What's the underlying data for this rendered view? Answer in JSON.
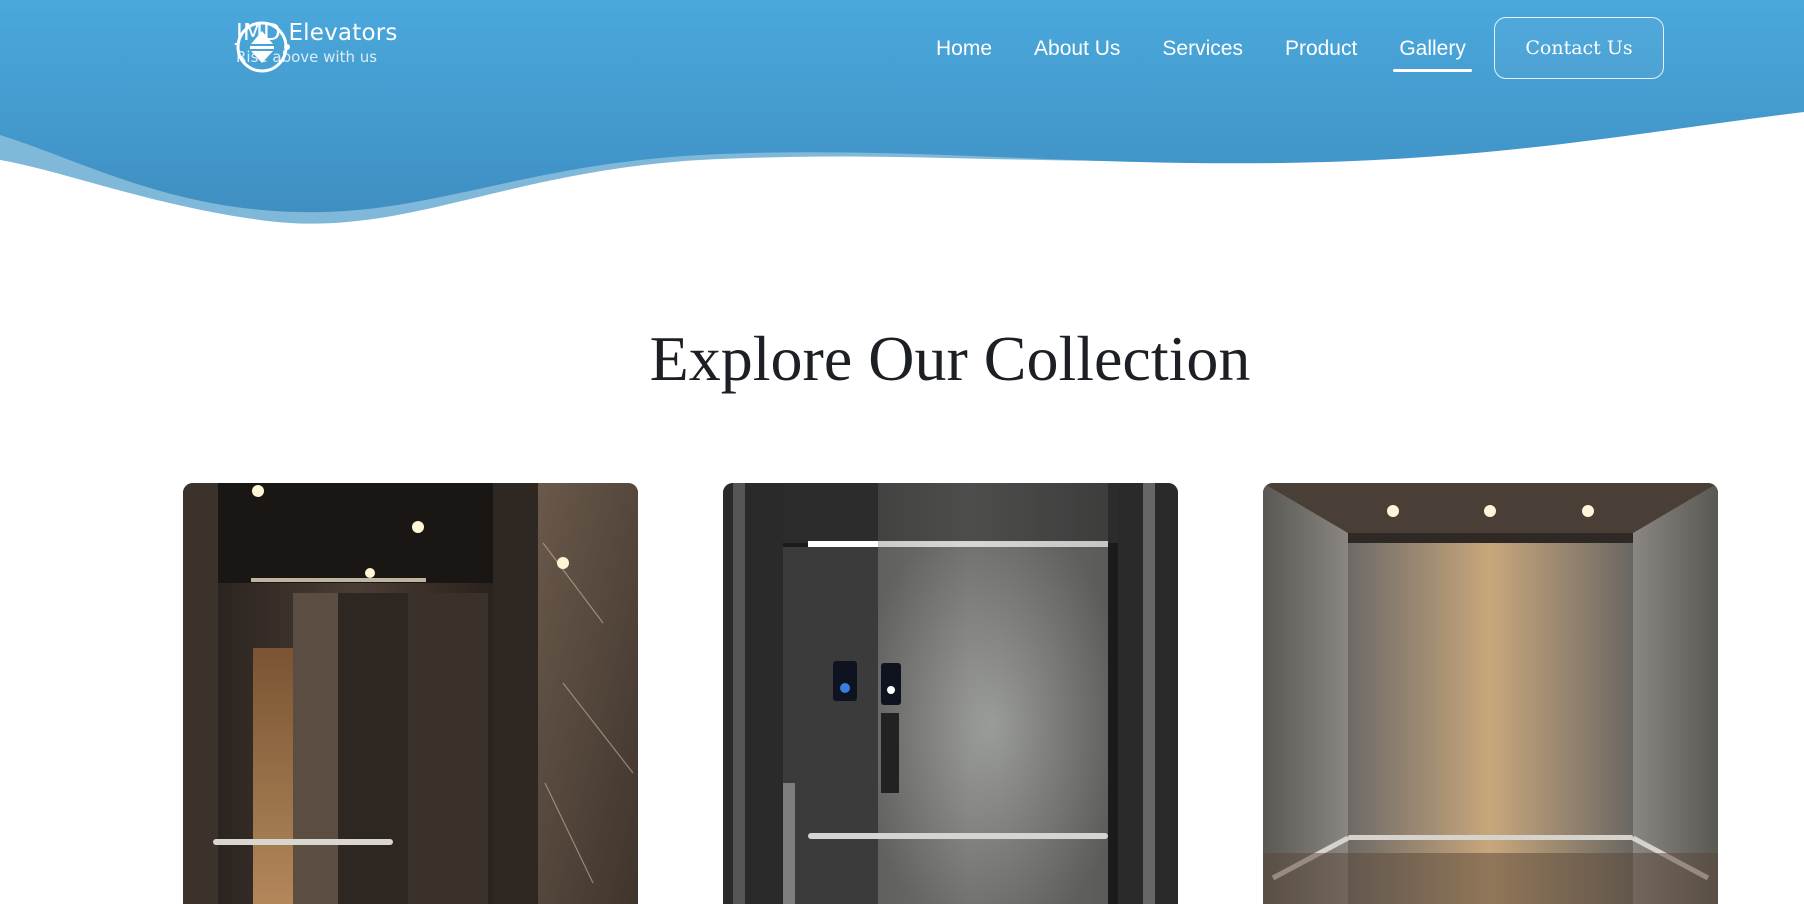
{
  "brand": {
    "name": "JMD Elevators",
    "tagline": "Rise above with us",
    "logo_icon": "elevator-up-down-icon"
  },
  "nav": {
    "items": [
      {
        "label": "Home",
        "active": false
      },
      {
        "label": "About Us",
        "active": false
      },
      {
        "label": "Services",
        "active": false
      },
      {
        "label": "Product",
        "active": false
      },
      {
        "label": "Gallery",
        "active": true
      }
    ],
    "contact_label": "Contact Us"
  },
  "colors": {
    "hero_top": "#4aa8dc",
    "hero_bottom": "#3f8fc2",
    "wave_light": "#7fb8d8",
    "title": "#1c1f24"
  },
  "main": {
    "title": "Explore Our Collection",
    "gallery": [
      {
        "name": "dark-bronze-elevator-interior-image"
      },
      {
        "name": "stainless-steel-elevator-interior-image"
      },
      {
        "name": "warm-brushed-elevator-interior-image"
      }
    ]
  }
}
